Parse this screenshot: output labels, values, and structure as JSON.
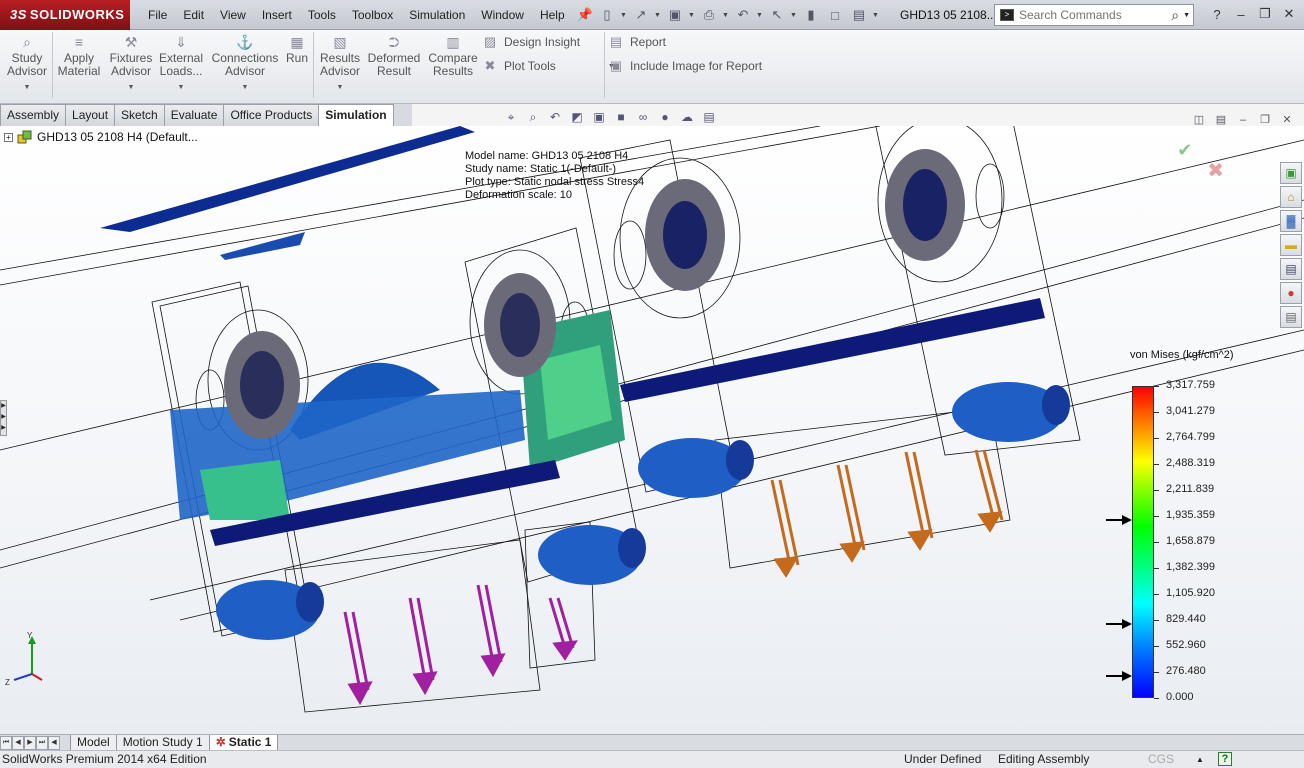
{
  "app": {
    "logo_text": "SOLIDWORKS",
    "logo_prefix": "3S",
    "document_title": "GHD13 05 2108...",
    "menus": [
      "File",
      "Edit",
      "View",
      "Insert",
      "Tools",
      "Toolbox",
      "Simulation",
      "Window",
      "Help"
    ],
    "search_placeholder": "Search Commands"
  },
  "ribbon": {
    "study_advisor": [
      "Study",
      "Advisor"
    ],
    "apply_material": [
      "Apply",
      "Material"
    ],
    "fixtures_advisor": [
      "Fixtures",
      "Advisor"
    ],
    "external_loads": [
      "External",
      "Loads..."
    ],
    "connections_advisor": [
      "Connections",
      "Advisor"
    ],
    "run": [
      "Run"
    ],
    "results_advisor": [
      "Results",
      "Advisor"
    ],
    "deformed_result": [
      "Deformed",
      "Result"
    ],
    "compare_results": [
      "Compare",
      "Results"
    ],
    "design_insight": "Design Insight",
    "plot_tools": "Plot Tools",
    "report": "Report",
    "include_image": "Include Image for Report"
  },
  "command_tabs": [
    {
      "label": "Assembly",
      "active": false
    },
    {
      "label": "Layout",
      "active": false
    },
    {
      "label": "Sketch",
      "active": false
    },
    {
      "label": "Evaluate",
      "active": false
    },
    {
      "label": "Office Products",
      "active": false
    },
    {
      "label": "Simulation",
      "active": true
    }
  ],
  "feature_tree": {
    "root_label": "GHD13 05 2108 H4  (Default..."
  },
  "plot_info": {
    "model_name": "Model name: GHD13 05 2108 H4",
    "study_name": "Study name: Static 1(-Default-)",
    "plot_type": "Plot type: Static nodal stress Stress4",
    "deformation": "Deformation scale: 10"
  },
  "legend": {
    "title": "von Mises (kgf/cm^2)",
    "values": [
      "3,317.759",
      "3,041.279",
      "2,764.799",
      "2,488.319",
      "2,211.839",
      "1,935.359",
      "1,658.879",
      "1,382.399",
      "1,105.920",
      "829.440",
      "552.960",
      "276.480",
      "0.000"
    ],
    "markers": [
      "1,935.359",
      "829.440",
      "276.480"
    ]
  },
  "triad": {
    "y": "Y",
    "z": "Z"
  },
  "bottom_tabs": [
    {
      "label": "Model",
      "active": false
    },
    {
      "label": "Motion Study 1",
      "active": false
    },
    {
      "label": "Static 1",
      "active": true
    }
  ],
  "status": {
    "edition": "SolidWorks Premium 2014 x64 Edition",
    "definition": "Under Defined",
    "mode": "Editing Assembly",
    "units": "CGS",
    "help": "?"
  },
  "colors": {
    "brand_red": "#a3171c",
    "stress_low": "#0a1a7a",
    "load_orange": "#c36a1c",
    "fixture_purple": "#a020a0"
  }
}
